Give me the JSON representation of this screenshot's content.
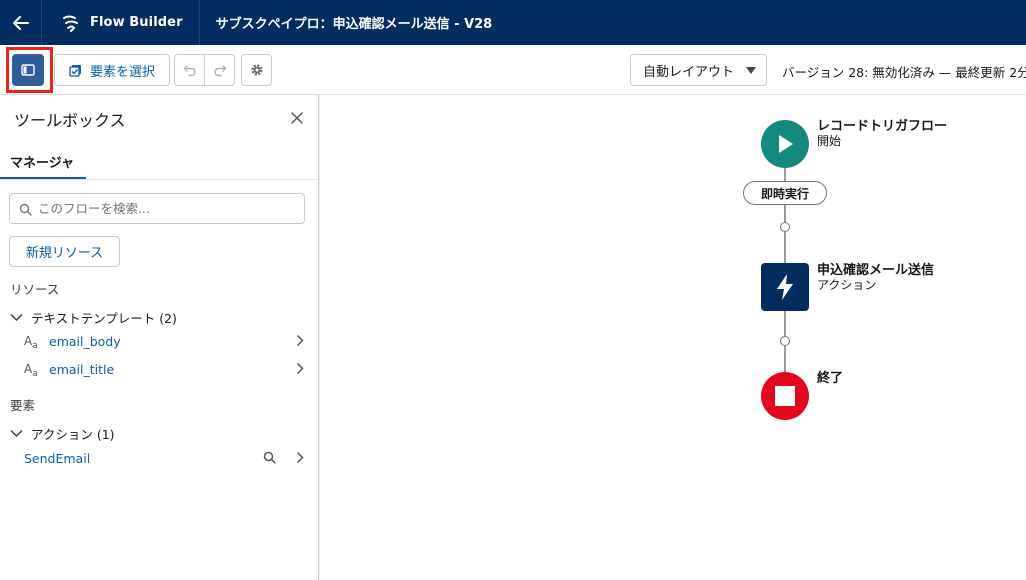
{
  "header": {
    "app_name": "Flow Builder",
    "flow_title": "サブスクペイプロ：申込確認メール送信 - V28"
  },
  "toolbar": {
    "select_elements_label": "要素を選択",
    "layout_value": "自動レイアウト",
    "version_info": "バージョン 28: 無効化済み — 最終更新 2分"
  },
  "toolbox": {
    "title": "ツールボックス",
    "tab_manager": "マネージャ",
    "search_placeholder": "このフローを検索...",
    "new_resource_label": "新規リソース",
    "resources_label": "リソース",
    "text_templates_group": "テキストテンプレート (2)",
    "text_templates": [
      {
        "label": "email_body",
        "type_glyph": "A",
        "type_glyph_sub": "a"
      },
      {
        "label": "email_title",
        "type_glyph": "A",
        "type_glyph_sub": "a"
      }
    ],
    "elements_label": "要素",
    "actions_group": "アクション (1)",
    "actions": [
      {
        "label": "SendEmail"
      }
    ]
  },
  "canvas": {
    "start": {
      "title": "レコードトリガフロー",
      "subtitle": "開始",
      "color": "#138a80",
      "icon": "play-icon"
    },
    "trigger_pill": "即時実行",
    "action": {
      "title": "申込確認メール送信",
      "subtitle": "アクション",
      "color": "#032d60",
      "icon": "lightning-icon"
    },
    "end": {
      "title": "終了",
      "color": "#e3061c",
      "icon": "stop-icon"
    }
  },
  "colors": {
    "header_bg": "#032d60",
    "link": "#0b5cab",
    "highlight": "#e8251a"
  }
}
